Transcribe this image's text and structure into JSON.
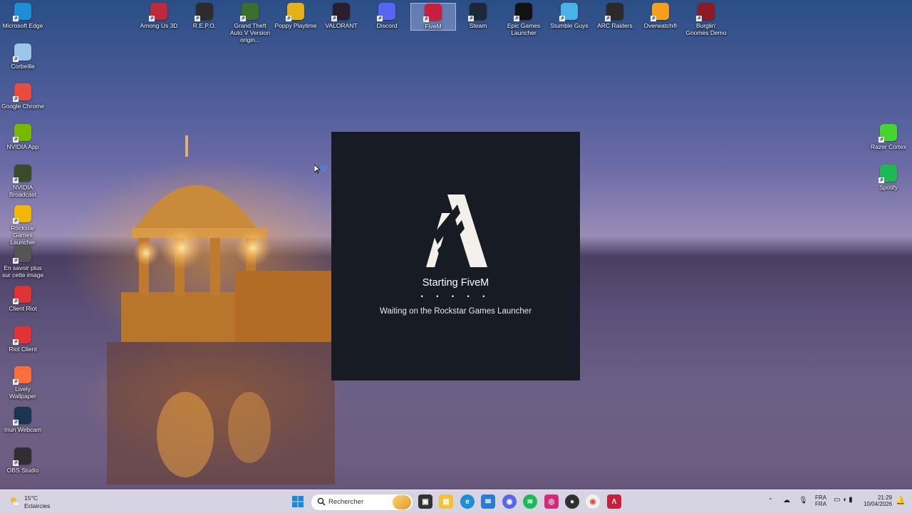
{
  "desktop": {
    "left_icons": [
      {
        "label": "Microsoft Edge",
        "icon": "edge-icon",
        "color": "#1e8fd6"
      },
      {
        "label": "Corbeille",
        "icon": "recycle-bin-icon",
        "color": "#9cc6e8"
      },
      {
        "label": "Google Chrome",
        "icon": "chrome-icon",
        "color": "#e74c3c"
      },
      {
        "label": "NVIDIA App",
        "icon": "nvidia-icon",
        "color": "#76b900"
      },
      {
        "label": "NVIDIA Broadcast",
        "icon": "nvidia-broadcast-icon",
        "color": "#3b4a2a"
      },
      {
        "label": "Rockstar Games Launcher",
        "icon": "rockstar-icon",
        "color": "#f2b800"
      },
      {
        "label": "En savoir plus sur cette image",
        "icon": "info-camera-icon",
        "color": "#555"
      },
      {
        "label": "Client Riot",
        "icon": "riot-icon",
        "color": "#e03333"
      },
      {
        "label": "Riot Client",
        "icon": "riot-icon",
        "color": "#e03333"
      },
      {
        "label": "Lively Wallpaper",
        "icon": "lively-wallpaper-icon",
        "color": "#ff6f3c"
      },
      {
        "label": "Iriun Webcam",
        "icon": "iriun-webcam-icon",
        "color": "#1a3550"
      },
      {
        "label": "OBS Studio",
        "icon": "obs-icon",
        "color": "#302e31"
      }
    ],
    "top_icons": [
      {
        "label": "Among Us 3D",
        "icon": "among-us-icon",
        "color": "#c0283c"
      },
      {
        "label": "R.E.P.O.",
        "icon": "repo-icon",
        "color": "#2c2c2c"
      },
      {
        "label": "Grand Theft Auto V Version origin...",
        "icon": "gta-icon",
        "color": "#3a6e2a"
      },
      {
        "label": "Poppy Playtime",
        "icon": "poppy-playtime-icon",
        "color": "#e4b218"
      },
      {
        "label": "VALORANT",
        "icon": "valorant-icon",
        "color": "#2a1e2a"
      },
      {
        "label": "Discord",
        "icon": "discord-icon",
        "color": "#5865f2"
      },
      {
        "label": "FiveM",
        "icon": "fivem-icon",
        "color": "#c8203c"
      },
      {
        "label": "Steam",
        "icon": "steam-icon",
        "color": "#1b2838"
      },
      {
        "label": "Epic Games Launcher",
        "icon": "epic-games-icon",
        "color": "#121212"
      },
      {
        "label": "Stumble Guys",
        "icon": "stumble-guys-icon",
        "color": "#4ab3e6"
      },
      {
        "label": "ARC Raiders",
        "icon": "arc-raiders-icon",
        "color": "#2a2a2a"
      },
      {
        "label": "Overwatch®",
        "icon": "overwatch-icon",
        "color": "#f99e1a"
      },
      {
        "label": "Burglin' Gnomes Demo",
        "icon": "burglin-gnomes-icon",
        "color": "#8c1c24"
      }
    ],
    "right_icons": [
      {
        "label": "Razer Cortex",
        "icon": "razer-cortex-icon",
        "color": "#44d62c"
      },
      {
        "label": "Spotify",
        "icon": "spotify-icon",
        "color": "#1db954"
      }
    ]
  },
  "splash": {
    "title": "Starting FiveM",
    "dots": "• • • • •",
    "status": "Waiting on the Rockstar Games Launcher"
  },
  "taskbar": {
    "weather_temp": "15°C",
    "weather_condition": "Eclaircies",
    "search_placeholder": "Rechercher",
    "lang_top": "FRA",
    "lang_bottom": "FRA",
    "time": "21:29",
    "date": "10/04/2026"
  }
}
